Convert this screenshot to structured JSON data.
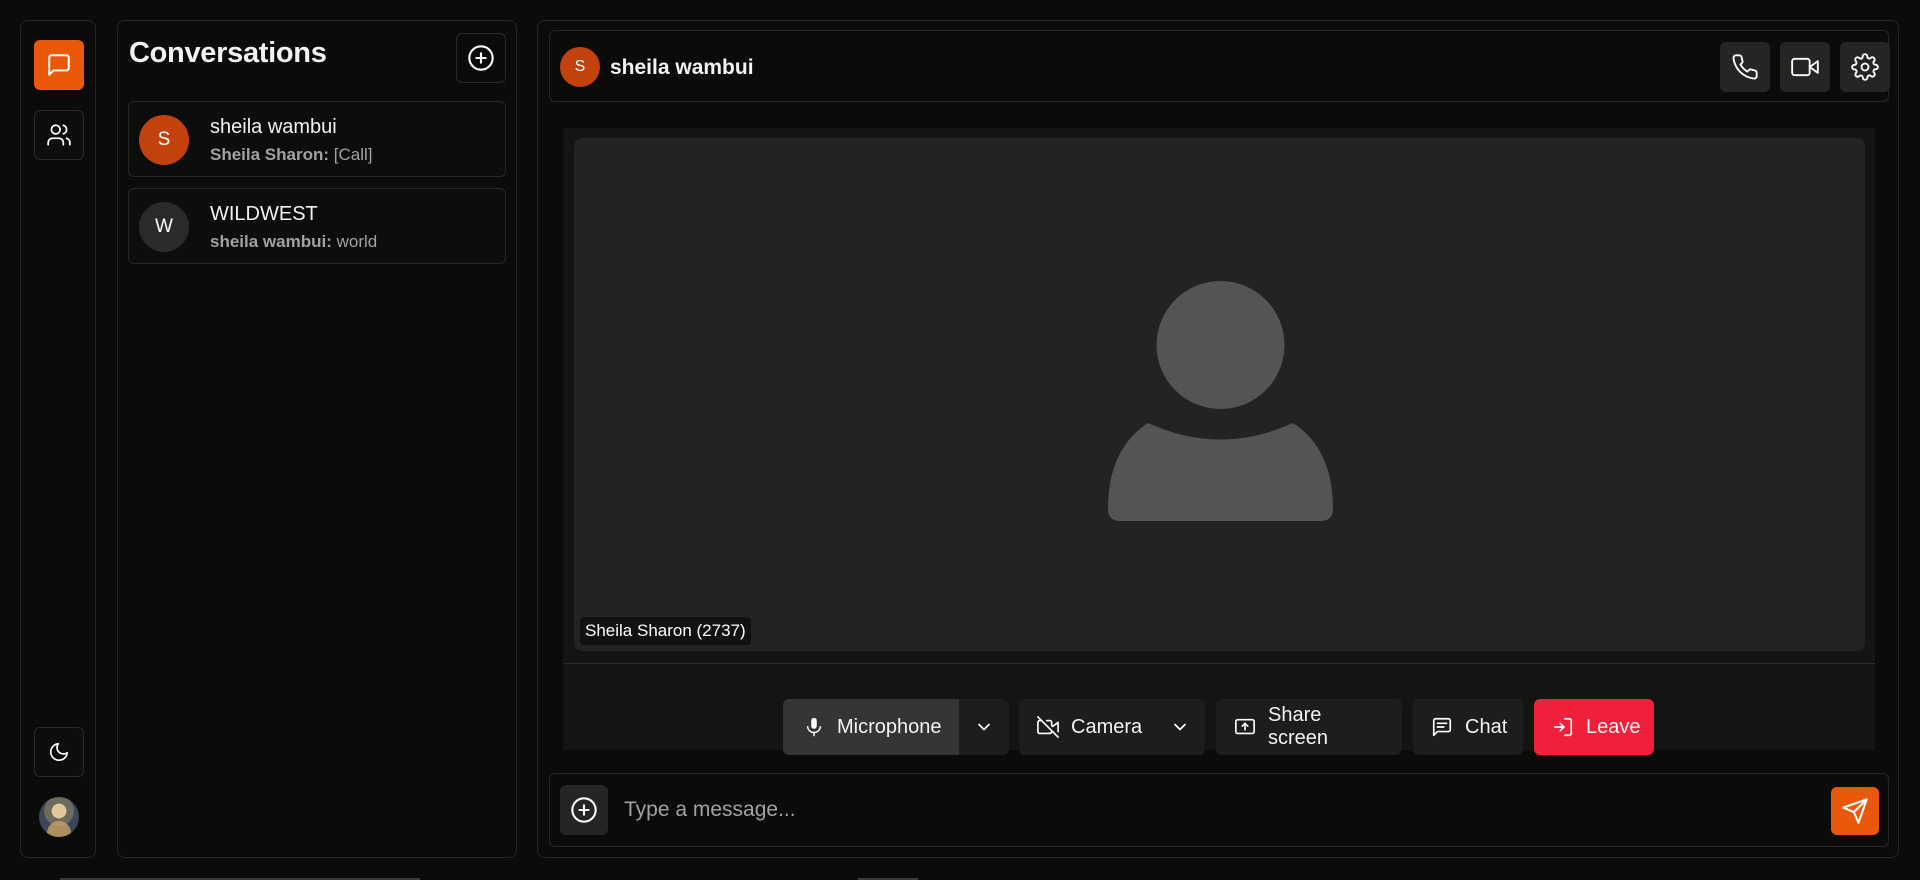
{
  "colors": {
    "accent": "#ea580c",
    "avatar_sheila": "#c2410c",
    "avatar_wildwest": "#2a2a28",
    "leave": "#f0203b",
    "background": "#0b0b0a"
  },
  "rail": {
    "items": [
      {
        "name": "chats",
        "icon": "message-square-icon",
        "active": true
      },
      {
        "name": "contacts",
        "icon": "users-icon",
        "active": false
      }
    ],
    "theme_icon": "moon-icon",
    "user_avatar": "user-avatar"
  },
  "sidebar": {
    "title": "Conversations",
    "new_icon": "plus-circle-icon",
    "conversations": [
      {
        "initial": "S",
        "name": "sheila wambui",
        "sender": "Sheila Sharon:",
        "message": "[Call]"
      },
      {
        "initial": "W",
        "name": "WILDWEST",
        "sender": "sheila wambui:",
        "message": "world"
      }
    ]
  },
  "header": {
    "initial": "S",
    "name": "sheila wambui",
    "actions": [
      "phone-icon",
      "video-icon",
      "settings-icon"
    ]
  },
  "call": {
    "participant_label": "Sheila Sharon (2737)",
    "controls": {
      "microphone": "Microphone",
      "camera": "Camera",
      "share_screen": "Share screen",
      "chat": "Chat",
      "leave": "Leave"
    }
  },
  "composer": {
    "placeholder": "Type a message...",
    "value": ""
  }
}
